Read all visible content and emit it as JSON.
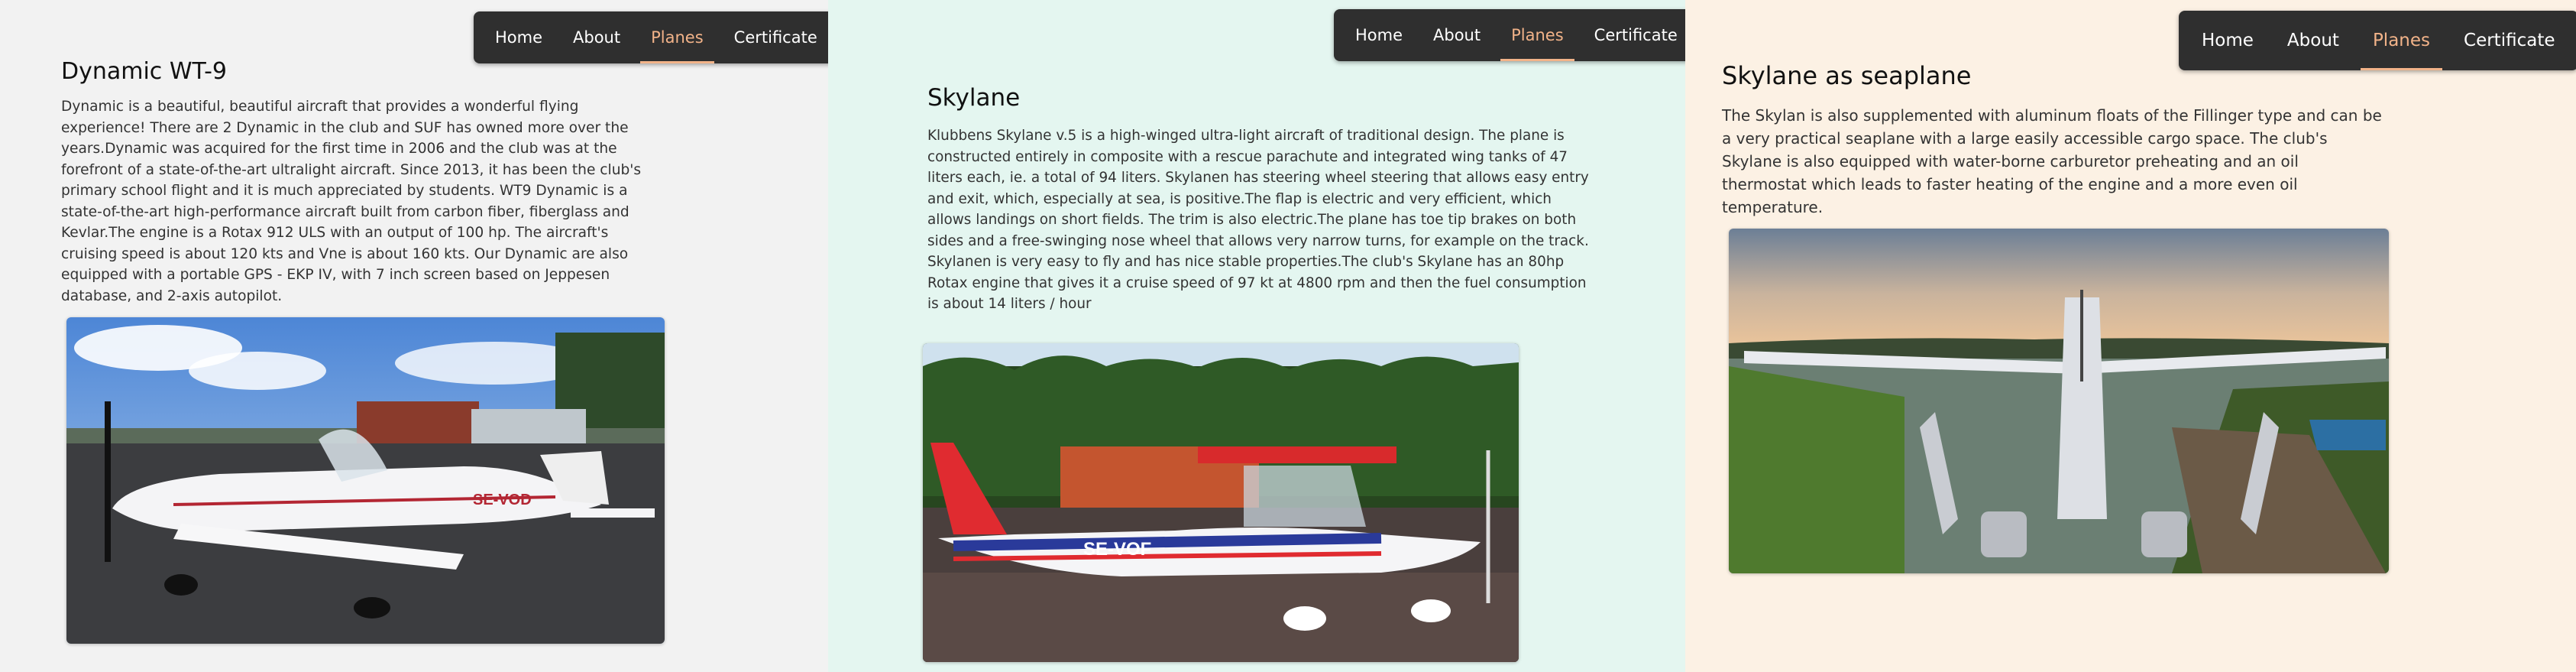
{
  "nav": {
    "items": [
      "Home",
      "About",
      "Planes",
      "Certificate"
    ],
    "active": "Planes"
  },
  "colors": {
    "nav_bg": "#2f2f2f",
    "nav_active": "#f2b389",
    "panel1_bg": "#f2f2f2",
    "panel2_bg": "#e4f6f0",
    "panel3_bg": "#fcf1e4"
  },
  "sections": [
    {
      "title": "Dynamic WT-9",
      "body": "Dynamic is a beautiful, beautiful aircraft that provides a wonderful flying experience! There are 2 Dynamic in the club and SUF has owned more over the years.Dynamic was acquired for the first time in 2006 and the club was at the forefront of a state-of-the-art ultralight aircraft. Since 2013, it has been the club's primary school flight and it is much appreciated by students. WT9 Dynamic is a state-of-the-art high-performance aircraft built from carbon fiber, fiberglass and Kevlar.The engine is a Rotax 912 ULS with an output of 100 hp. The aircraft's cruising speed is about 120 kts and Vne is about 160 kts. Our Dynamic are also equipped with a portable GPS - EKP IV, with 7 inch screen based on Jeppesen database, and 2-axis autopilot.",
      "image_registration": "SE-VOD"
    },
    {
      "title": "Skylane",
      "body": "Klubbens Skylane v.5 is a high-winged ultra-light aircraft of traditional design. The plane is constructed entirely in composite with a rescue parachute and integrated wing tanks of 47 liters each, ie. a total of 94 liters. Skylanen has steering wheel steering that allows easy entry and exit, which, especially at sea, is positive.The flap is electric and very efficient, which allows landings on short fields. The trim is also electric.The plane has toe tip brakes on both sides and a free-swinging nose wheel that allows very narrow turns, for example on the track. Skylanen is very easy to fly and has nice stable properties.The club's Skylane has an 80hp Rotax engine that gives it a cruise speed of 97 kt at 4800 rpm and then the fuel consumption is about 14 liters / hour",
      "image_registration": "SE-VOF"
    },
    {
      "title": "Skylane as seaplane",
      "body": "The Skylan is also supplemented with aluminum floats of the Fillinger type and can be a very practical seaplane with a large easily accessible cargo space. The club's Skylane is also equipped with water-borne carburetor preheating and an oil thermostat which leads to faster heating of the engine and a more even oil temperature."
    }
  ]
}
